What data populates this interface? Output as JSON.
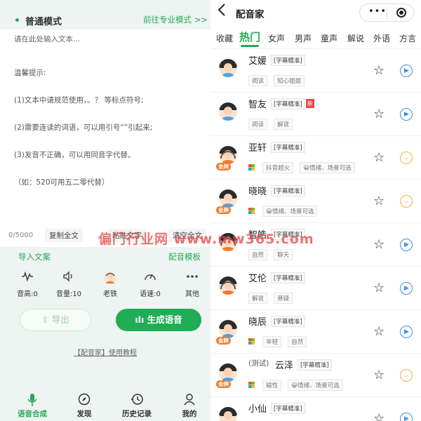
{
  "left": {
    "mode_title": "普通模式",
    "pro_link": "前往专业模式 >>",
    "editor_placeholder": "请在此处输入文本...",
    "tips_lines": [
      "温馨提示:",
      "(1)文本中请规范使用，。？ 等标点符号;",
      "(2)需要连读的词语，可以用引号“”引起来;",
      "(3)发音不正确，可以用同音字代替。",
      "（如：520可用五二零代替）"
    ],
    "counter": "0/5000",
    "copy_all": "复制全文",
    "paste_text": "粘贴文字",
    "clear_all": "清空全文",
    "import_text": "导入文案",
    "dub_template": "配音模板",
    "controls": [
      {
        "icon": "waveform-icon",
        "label": "音高:0"
      },
      {
        "icon": "volume-icon",
        "label": "音量:10"
      },
      {
        "icon": "voice-avatar-icon",
        "label": "老铁"
      },
      {
        "icon": "speedometer-icon",
        "label": "语速:0"
      },
      {
        "icon": "more-icon",
        "label": "其他"
      }
    ],
    "export_label": "导出",
    "generate_label": "生成语音",
    "tutorial": "【配音家】使用教程",
    "tabs": [
      {
        "icon": "microphone-icon",
        "label": "语音合成",
        "active": true
      },
      {
        "icon": "compass-icon",
        "label": "发现",
        "active": false
      },
      {
        "icon": "history-icon",
        "label": "历史记录",
        "active": false
      },
      {
        "icon": "user-icon",
        "label": "我的",
        "active": false
      }
    ]
  },
  "right": {
    "title": "配音家",
    "categories": [
      "收藏",
      "热门",
      "女声",
      "男声",
      "童声",
      "解说",
      "外语",
      "方言"
    ],
    "active_category": "热门",
    "voices": [
      {
        "name": "艾媛",
        "subtitle_badge": "[字幕精准]",
        "tags": [
          "阅读",
          "知心姐姐"
        ],
        "avatar": "female",
        "gold": false,
        "action": "play"
      },
      {
        "name": "智友",
        "subtitle_badge": "[字幕精准]",
        "new_badge": "新",
        "tags": [
          "阅读",
          "解说"
        ],
        "avatar": "male",
        "gold": false,
        "action": "play"
      },
      {
        "name": "亚轩",
        "subtitle_badge": "[字幕精准]",
        "tags": [
          "抖音超火",
          "😀情绪、场景可选"
        ],
        "avatar": "headset",
        "gold": true,
        "gold_label": "金牌",
        "ms_icon": true,
        "action": "expand"
      },
      {
        "name": "晓晓",
        "subtitle_badge": "[字幕精准]",
        "tags": [
          "😀情绪、场景可选"
        ],
        "avatar": "female",
        "gold": true,
        "gold_label": "金牌",
        "ms_icon": true,
        "action": "expand"
      },
      {
        "name": "智皓",
        "subtitle_badge": "[字幕精准]",
        "tags": [
          "自然",
          "聊天"
        ],
        "avatar": "headset",
        "gold": false,
        "action": "play"
      },
      {
        "name": "艾伦",
        "subtitle_badge": "[字幕精准]",
        "tags": [
          "解说",
          "悬疑"
        ],
        "avatar": "headset",
        "gold": false,
        "action": "play"
      },
      {
        "name": "晓辰",
        "subtitle_badge": "[字幕精准]",
        "tags": [
          "年轻",
          "自然"
        ],
        "avatar": "female",
        "gold": true,
        "gold_label": "金牌",
        "ms_icon": true,
        "action": "play"
      },
      {
        "name_prefix": "(测试)",
        "name": "云泽",
        "subtitle_badge": "[字幕精准]",
        "tags": [
          "磁性",
          "😀情绪、场景可选"
        ],
        "avatar": "male",
        "gold": true,
        "gold_label": "金牌",
        "ms_icon": true,
        "action": "expand"
      },
      {
        "name": "小仙",
        "subtitle_badge": "[字幕精准]",
        "tags": [],
        "avatar": "female",
        "gold": false,
        "action": "play"
      }
    ]
  },
  "watermark": "偏门行业网 www.mw365.com",
  "colors": {
    "accent_green": "#27a85a",
    "play_blue": "#3e8ee8",
    "expand_yellow": "#e9b63a",
    "gold_orange": "#f07b2c",
    "new_red": "#e84a4a"
  }
}
